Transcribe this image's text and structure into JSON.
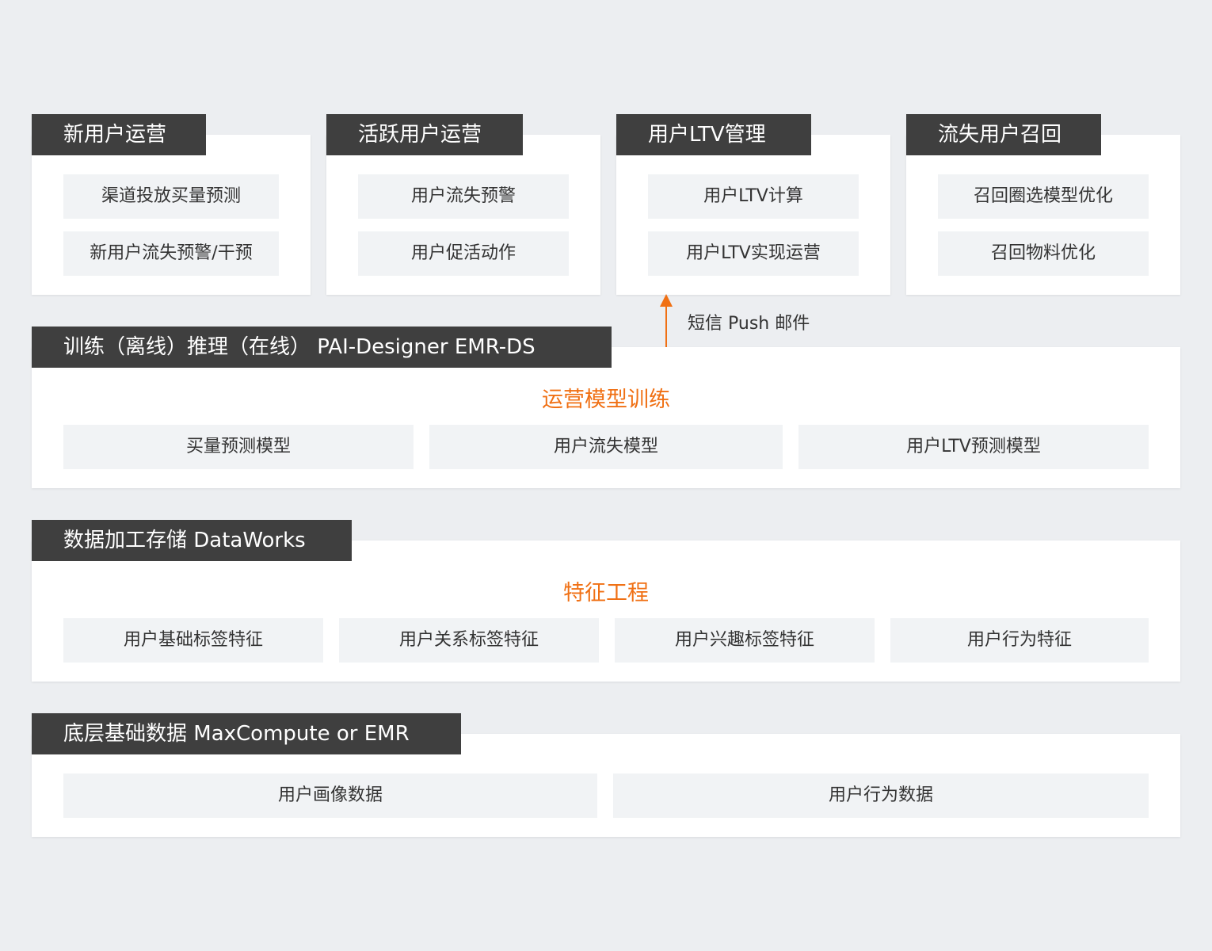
{
  "scenarios": [
    {
      "title": "新用户运营",
      "items": [
        "渠道投放买量预测",
        "新用户流失预警/干预"
      ]
    },
    {
      "title": "活跃用户运营",
      "items": [
        "用户流失预警",
        "用户促活动作"
      ]
    },
    {
      "title": "用户LTV管理",
      "items": [
        "用户LTV计算",
        "用户LTV实现运营"
      ]
    },
    {
      "title": "流失用户召回",
      "items": [
        "召回圈选模型优化",
        "召回物料优化"
      ]
    }
  ],
  "channels": "短信 Push 邮件",
  "training": {
    "tag": "训练（离线）推理（在线） PAI-Designer EMR-DS",
    "title": "运营模型训练",
    "items": [
      "买量预测模型",
      "用户流失模型",
      "用户LTV预测模型"
    ]
  },
  "processing": {
    "tag": "数据加工存储 DataWorks",
    "title": "特征工程",
    "items": [
      "用户基础标签特征",
      "用户关系标签特征",
      "用户兴趣标签特征",
      "用户行为特征"
    ]
  },
  "base": {
    "tag": "底层基础数据 MaxCompute or EMR",
    "items": [
      "用户画像数据",
      "用户行为数据"
    ]
  },
  "colors": {
    "accent": "#f07014",
    "tag_bg": "#3f3f3f",
    "pill_bg": "#f1f3f5",
    "page_bg": "#eceef1"
  }
}
